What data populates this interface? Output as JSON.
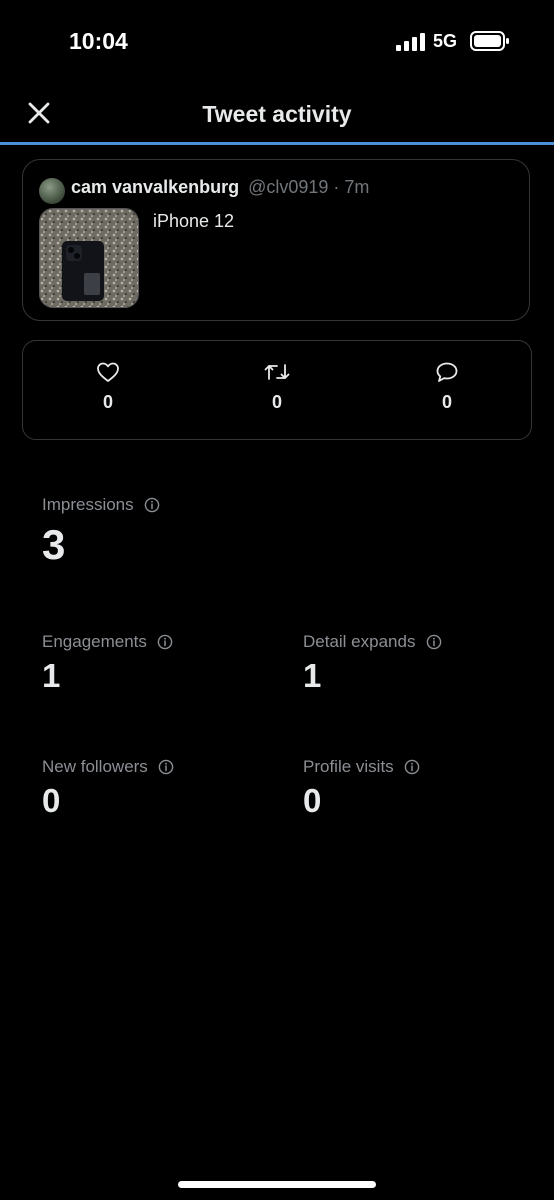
{
  "status_bar": {
    "time": "10:04",
    "network": "5G",
    "icons": [
      "signal-icon",
      "battery-icon"
    ]
  },
  "header": {
    "title": "Tweet activity",
    "close_icon": "close-icon",
    "accent_color": "#4a90d9"
  },
  "tweet": {
    "author_name": "cam vanvalkenburg",
    "handle_time": "@clv0919 · 7m",
    "text": "iPhone 12"
  },
  "engagement_counts": {
    "likes": "0",
    "retweets": "0",
    "replies": "0",
    "icons": [
      "heart-icon",
      "retweet-icon",
      "reply-icon"
    ]
  },
  "stats": {
    "impressions": {
      "label": "Impressions",
      "value": "3"
    },
    "engagements": {
      "label": "Engagements",
      "value": "1"
    },
    "detail_expands": {
      "label": "Detail expands",
      "value": "1"
    },
    "new_followers": {
      "label": "New followers",
      "value": "0"
    },
    "profile_visits": {
      "label": "Profile visits",
      "value": "0"
    }
  }
}
